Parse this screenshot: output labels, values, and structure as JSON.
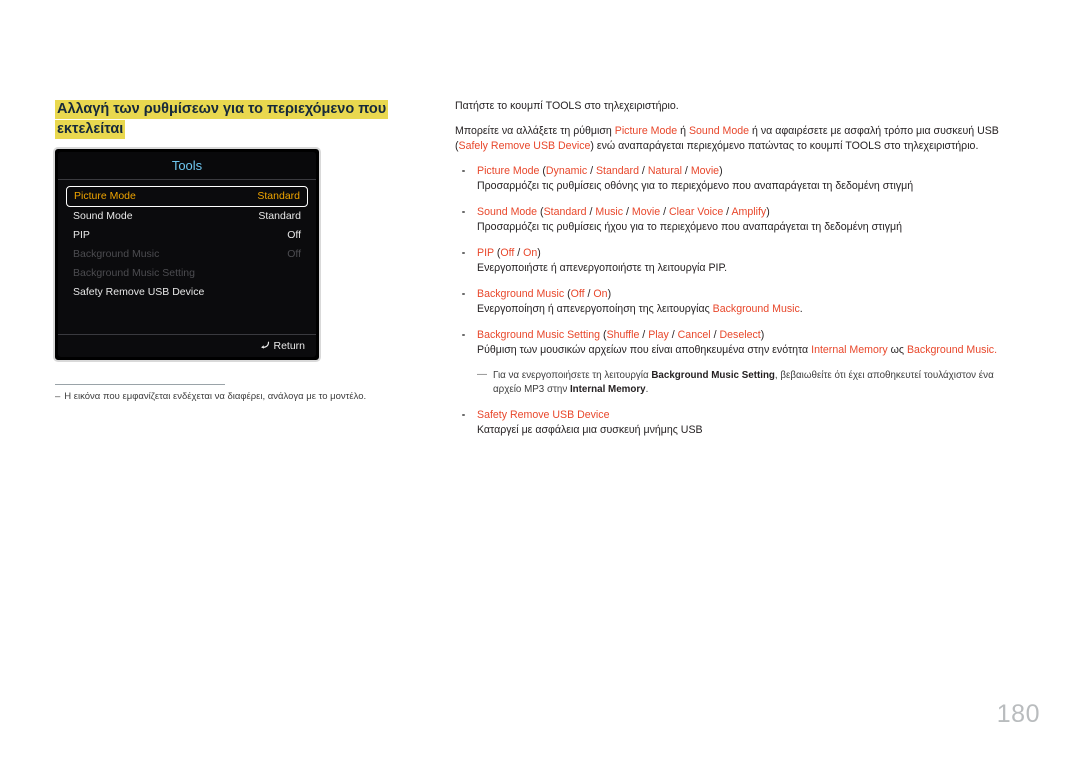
{
  "page": {
    "number": "180",
    "heading_line1": "Αλλαγή των ρυθμίσεων για το περιεχόμενο που",
    "heading_line2": "εκτελείται",
    "highlight_color": "#e9d84f",
    "accent_color": "#e8472b",
    "heading_text_color": "#16293a"
  },
  "osd": {
    "title": "Tools",
    "rows": [
      {
        "label": "Picture Mode",
        "value": "Standard",
        "state": "selected"
      },
      {
        "label": "Sound Mode",
        "value": "Standard",
        "state": "normal"
      },
      {
        "label": "PIP",
        "value": "Off",
        "state": "normal"
      },
      {
        "label": "Background Music",
        "value": "Off",
        "state": "disabled"
      },
      {
        "label": "Background Music Setting",
        "value": "",
        "state": "disabled"
      },
      {
        "label": "Safety Remove USB Device",
        "value": "",
        "state": "normal"
      }
    ],
    "footer_label": "Return",
    "footer_icon": "return-arrow-icon",
    "title_color": "#6fc7f0",
    "selected_color": "#f0a500"
  },
  "left_note": {
    "dash": "–",
    "text": "Η εικόνα που εμφανίζεται ενδέχεται να διαφέρει, ανάλογα με το μοντέλο."
  },
  "right": {
    "para1": "Πατήστε το κουμπί TOOLS στο τηλεχειριστήριο.",
    "para2": {
      "s1": "Μπορείτε να αλλάξετε τη ρύθμιση ",
      "r1": "Picture Mode",
      "s2": " ή ",
      "r2": "Sound Mode",
      "s3": " ή να αφαιρέσετε με ασφαλή τρόπο μια συσκευή USB (",
      "r3": "Safely Remove USB Device",
      "s4": ") ενώ αναπαράγεται περιεχόμενο πατώντας το κουμπί TOOLS στο τηλεχειριστήριο."
    },
    "bullets": [
      {
        "name": "picture-mode",
        "title_red": "Picture Mode",
        "title_rest_open": " (",
        "options": [
          "Dynamic",
          "Standard",
          "Natural",
          "Movie"
        ],
        "title_rest_close": ")",
        "desc": "Προσαρμόζει τις ρυθμίσεις οθόνης για το περιεχόμενο που αναπαράγεται τη δεδομένη στιγμή"
      },
      {
        "name": "sound-mode",
        "title_red": "Sound Mode",
        "title_rest_open": " (",
        "options": [
          "Standard",
          "Music",
          "Movie",
          "Clear Voice",
          "Amplify"
        ],
        "title_rest_close": ")",
        "desc": "Προσαρμόζει τις ρυθμίσεις ήχου για το περιεχόμενο που αναπαράγεται τη δεδομένη στιγμή"
      },
      {
        "name": "pip",
        "title_red": "PIP",
        "title_rest_open": " (",
        "options": [
          "Off",
          "On"
        ],
        "title_rest_close": ")",
        "desc": "Ενεργοποιήστε ή απενεργοποιήστε τη λειτουργία PIP."
      },
      {
        "name": "background-music",
        "title_red": "Background Music",
        "title_rest_open": " (",
        "options": [
          "Off",
          "On"
        ],
        "title_rest_close": ")",
        "desc_pre": "Ενεργοποίηση ή απενεργοποίηση της λειτουργίας ",
        "desc_red": "Background Music",
        "desc_post": "."
      },
      {
        "name": "background-music-setting",
        "title_red": "Background Music Setting",
        "title_rest_open": " (",
        "options": [
          "Shuffle",
          "Play",
          "Cancel",
          "Deselect"
        ],
        "title_rest_close": ")",
        "desc_pre": "Ρύθμιση των μουσικών αρχείων που είναι αποθηκευμένα στην ενότητα ",
        "desc_red": "Internal Memory",
        "desc_mid": " ως ",
        "desc_red2": "Background Music",
        "desc_post": "."
      }
    ],
    "subnote": {
      "dash": "―",
      "s1": "Για να ενεργοποιήσετε τη λειτουργία ",
      "b1": "Background Music Setting",
      "s2": ", βεβαιωθείτε ότι έχει αποθηκευτεί τουλάχιστον ένα αρχείο MP3 στην ",
      "b2": "Internal Memory",
      "s3": "."
    },
    "last_bullet": {
      "name": "safety-remove-usb-device",
      "title_red": "Safety Remove USB Device",
      "desc": "Καταργεί με ασφάλεια μια συσκευή μνήμης USB"
    }
  }
}
